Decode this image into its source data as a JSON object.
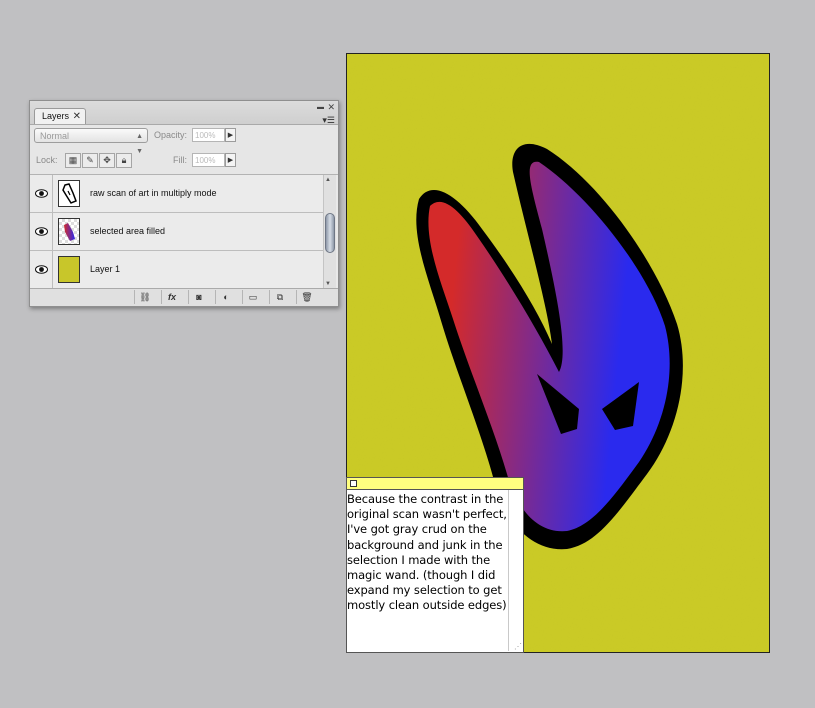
{
  "panel": {
    "tab_label": "Layers",
    "tab_close": "✕",
    "minimize_glyph": "▬",
    "close_glyph": "✕",
    "menu_glyph": "▾☰",
    "blend_mode": "Normal",
    "opacity_label": "Opacity:",
    "opacity_value": "100%",
    "lock_label": "Lock:",
    "fill_label": "Fill:",
    "fill_value": "100%",
    "layers": [
      {
        "name": "raw scan of art in multiply mode",
        "thumb": "line-art-thumbnail"
      },
      {
        "name": "selected area filled",
        "thumb": "filled-shape-thumbnail"
      },
      {
        "name": "Layer 1",
        "thumb": "yellow-fill-thumbnail",
        "thumb_color": "#c8c62a"
      }
    ],
    "bottom_buttons": [
      "link-icon",
      "fx-icon",
      "mask-icon",
      "adjustment-icon",
      "folder-icon",
      "new-layer-icon",
      "trash-icon"
    ],
    "fx_label": "fx"
  },
  "colors": {
    "canvas_bg": "#cccc28",
    "gradient_left": "#d42a2a",
    "gradient_right": "#2a2aee",
    "note_header": "#ffff80"
  },
  "note": {
    "text": "Because the contrast in the original scan wasn't perfect, I've got gray crud on the background and junk in the selection I made with the magic wand. (though I did expand my selection to get mostly clean outside edges)"
  }
}
